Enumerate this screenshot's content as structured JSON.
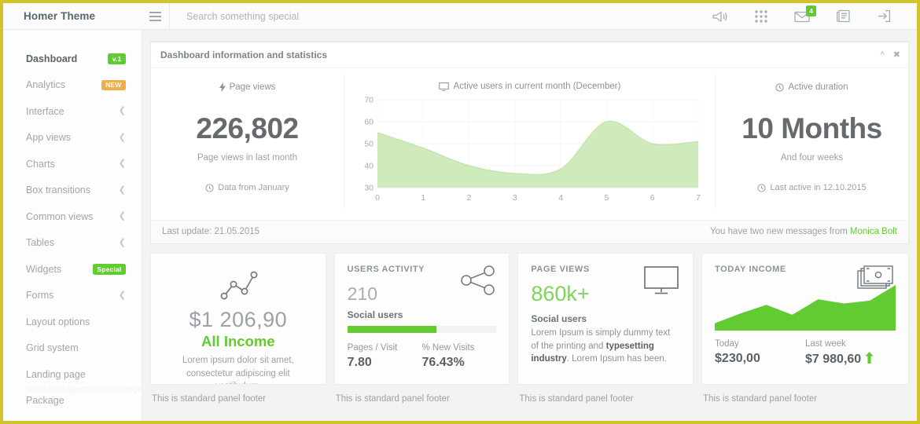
{
  "theme": {
    "accent_green": "#62cb31",
    "border_gold": "#d4c42c",
    "badge_orange": "#f0ad4e",
    "text_muted": "#9aa1a6"
  },
  "topnav": {
    "brand": "Homer Theme",
    "menu_icon": "hamburger-icon",
    "search": {
      "placeholder": "Search something special",
      "value": ""
    },
    "icons": [
      {
        "name": "megaphone-icon",
        "label": "Announcements"
      },
      {
        "name": "grid-dots-icon",
        "label": "Apps"
      },
      {
        "name": "envelope-icon",
        "label": "Messages",
        "badge": "4"
      },
      {
        "name": "newspaper-icon",
        "label": "News"
      },
      {
        "name": "sign-out-icon",
        "label": "Logout"
      }
    ]
  },
  "sidebar": {
    "watermark": "www.heritagechristiancollege.com",
    "items": [
      {
        "label": "Dashboard",
        "badge": "v.1",
        "badge_color": "green",
        "active": true,
        "chevron": false
      },
      {
        "label": "Analytics",
        "badge": "NEW",
        "badge_color": "orange",
        "active": false,
        "chevron": false
      },
      {
        "label": "Interface",
        "badge": null,
        "badge_color": null,
        "active": false,
        "chevron": true
      },
      {
        "label": "App views",
        "badge": null,
        "badge_color": null,
        "active": false,
        "chevron": true
      },
      {
        "label": "Charts",
        "badge": null,
        "badge_color": null,
        "active": false,
        "chevron": true
      },
      {
        "label": "Box transitions",
        "badge": null,
        "badge_color": null,
        "active": false,
        "chevron": true
      },
      {
        "label": "Common views",
        "badge": null,
        "badge_color": null,
        "active": false,
        "chevron": true
      },
      {
        "label": "Tables",
        "badge": null,
        "badge_color": null,
        "active": false,
        "chevron": true
      },
      {
        "label": "Widgets",
        "badge": "Special",
        "badge_color": "green",
        "active": false,
        "chevron": false
      },
      {
        "label": "Forms",
        "badge": null,
        "badge_color": null,
        "active": false,
        "chevron": true
      },
      {
        "label": "Layout options",
        "badge": null,
        "badge_color": null,
        "active": false,
        "chevron": false
      },
      {
        "label": "Grid system",
        "badge": null,
        "badge_color": null,
        "active": false,
        "chevron": false
      },
      {
        "label": "Landing page",
        "badge": null,
        "badge_color": null,
        "active": false,
        "chevron": false
      },
      {
        "label": "Package",
        "badge": null,
        "badge_color": null,
        "active": false,
        "chevron": false
      }
    ]
  },
  "main_panel": {
    "title": "Dashboard information and statistics",
    "collapse_icon": "chevron-up-icon",
    "close_icon": "close-icon",
    "left_stat": {
      "caption": "Page views",
      "caption_icon": "bolt-icon",
      "value": "226,802",
      "subtitle": "Page views in last month",
      "footer": "Data from January",
      "footer_icon": "clock-icon"
    },
    "right_stat": {
      "caption": "Active duration",
      "caption_icon": "clock-icon",
      "value": "10 Months",
      "subtitle": "And four weeks",
      "footer": "Last active in 12.10.2015",
      "footer_icon": "clock-icon"
    },
    "footer": {
      "last_update": "Last update: 21.05.2015",
      "message_prefix": "You have two new messages from ",
      "message_user": "Monica Bolt"
    }
  },
  "chart_data": {
    "type": "area",
    "title": "Active users in current month (December)",
    "title_icon": "monitor-icon",
    "x": [
      0,
      1,
      2,
      3,
      4,
      5,
      6,
      7
    ],
    "values": [
      55,
      48,
      40,
      36.5,
      38.5,
      60,
      50,
      51
    ],
    "xlabel": "",
    "ylabel": "",
    "xlim": [
      0,
      7
    ],
    "ylim": [
      30,
      70
    ],
    "xticks": [
      "0",
      "1",
      "2",
      "3",
      "4",
      "5",
      "6",
      "7"
    ],
    "yticks": [
      "30",
      "40",
      "50",
      "60",
      "70"
    ],
    "grid": true,
    "series_color": "#cfeabb",
    "legend": "none"
  },
  "cards": [
    {
      "id": "all-income",
      "icon": "line-chart-icon",
      "amount": "$1 206,90",
      "title": "All Income",
      "description": "Lorem ipsum dolor sit amet, consectetur adipiscing elit vestibulum.",
      "footer": "This is standard panel footer"
    },
    {
      "id": "users-activity",
      "label": "USERS ACTIVITY",
      "icon": "share-icon",
      "number": "210",
      "subtitle": "Social users",
      "progress_percent": 60,
      "metrics": [
        {
          "key": "Pages / Visit",
          "value": "7.80"
        },
        {
          "key": "% New Visits",
          "value": "76.43%"
        }
      ],
      "footer": "This is standard panel footer"
    },
    {
      "id": "page-views",
      "label": "PAGE VIEWS",
      "icon": "monitor-icon",
      "number": "860k+",
      "subtitle": "Social users",
      "desc_part1": "Lorem Ipsum is simply dummy text of the printing and ",
      "desc_bold": "typesetting industry",
      "desc_part2": ". Lorem Ipsum has been.",
      "footer": "This is standard panel footer"
    },
    {
      "id": "today-income",
      "label": "TODAY INCOME",
      "icon": "money-icon",
      "sparkline": [
        8,
        22,
        34,
        20,
        42,
        36,
        40,
        62
      ],
      "metrics": [
        {
          "key": "Today",
          "value": "$230,00"
        },
        {
          "key": "Last week",
          "value": "$7 980,60",
          "trend": "up",
          "trend_icon": "arrow-up-icon"
        }
      ],
      "footer": "This is standard panel footer"
    }
  ]
}
